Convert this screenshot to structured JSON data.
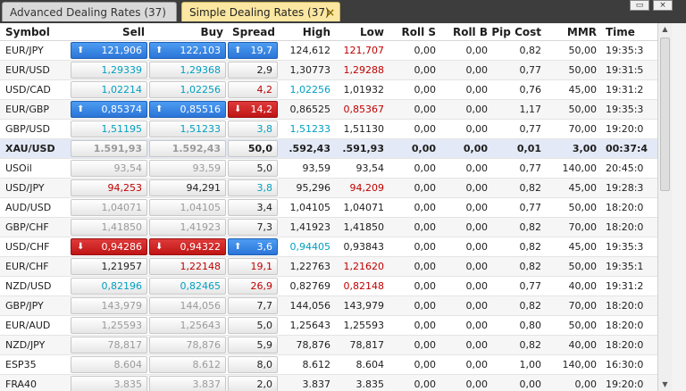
{
  "tabs": {
    "advanced": "Advanced Dealing Rates (37)",
    "simple": "Simple Dealing Rates (37)",
    "close": "×"
  },
  "window": {
    "restore": "▭",
    "close": "×"
  },
  "columns": [
    "Symbol",
    "Sell",
    "Buy",
    "Spread",
    "High",
    "Low",
    "Roll S",
    "Roll B",
    "Pip Cost",
    "MMR",
    "Time"
  ],
  "colors": {
    "up": "#2b75d8",
    "down": "#bf1515",
    "cyan_text": "#00a0c0",
    "red_text": "#c00000",
    "grey_text": "#9a9a9a",
    "tab_active": "#fbe7a1"
  },
  "rows": [
    {
      "symbol": "EUR/JPY",
      "sell": "121,906",
      "buy": "122,103",
      "spread": "19,7",
      "high": "124,612",
      "low": "121,707",
      "roll_s": "0,00",
      "roll_b": "0,00",
      "pip_cost": "0,82",
      "mmr": "50,00",
      "time": "19:35:3",
      "sell_style": "up",
      "buy_style": "up",
      "spread_style": "up",
      "low_color": "red"
    },
    {
      "symbol": "EUR/USD",
      "sell": "1,29339",
      "buy": "1,29368",
      "spread": "2,9",
      "high": "1,30773",
      "low": "1,29288",
      "roll_s": "0,00",
      "roll_b": "0,00",
      "pip_cost": "0,77",
      "mmr": "50,00",
      "time": "19:31:5",
      "sell_color": "cyan",
      "buy_color": "cyan",
      "low_color": "red"
    },
    {
      "symbol": "USD/CAD",
      "sell": "1,02214",
      "buy": "1,02256",
      "spread": "4,2",
      "high": "1,02256",
      "low": "1,01932",
      "roll_s": "0,00",
      "roll_b": "0,00",
      "pip_cost": "0,76",
      "mmr": "45,00",
      "time": "19:31:2",
      "sell_color": "cyan",
      "buy_color": "cyan",
      "spread_color": "red",
      "high_color": "cyan"
    },
    {
      "symbol": "EUR/GBP",
      "sell": "0,85374",
      "buy": "0,85516",
      "spread": "14,2",
      "high": "0,86525",
      "low": "0,85367",
      "roll_s": "0,00",
      "roll_b": "0,00",
      "pip_cost": "1,17",
      "mmr": "50,00",
      "time": "19:35:3",
      "sell_style": "up",
      "buy_style": "up",
      "spread_style": "down",
      "low_color": "red"
    },
    {
      "symbol": "GBP/USD",
      "sell": "1,51195",
      "buy": "1,51233",
      "spread": "3,8",
      "high": "1,51233",
      "low": "1,51130",
      "roll_s": "0,00",
      "roll_b": "0,00",
      "pip_cost": "0,77",
      "mmr": "70,00",
      "time": "19:20:0",
      "sell_color": "cyan",
      "buy_color": "cyan",
      "spread_color": "cyan",
      "high_color": "cyan"
    },
    {
      "symbol": "XAU/USD",
      "sell": "1.591,93",
      "buy": "1.592,43",
      "spread": "50,0",
      "high": ".592,43",
      "low": ".591,93",
      "roll_s": "0,00",
      "roll_b": "0,00",
      "pip_cost": "0,01",
      "mmr": "3,00",
      "time": "00:37:4",
      "sell_color": "grey",
      "buy_color": "grey",
      "selected": true
    },
    {
      "symbol": "USOil",
      "sell": "93,54",
      "buy": "93,59",
      "spread": "5,0",
      "high": "93,59",
      "low": "93,54",
      "roll_s": "0,00",
      "roll_b": "0,00",
      "pip_cost": "0,77",
      "mmr": "140,00",
      "time": "20:45:0",
      "sell_color": "grey",
      "buy_color": "grey"
    },
    {
      "symbol": "USD/JPY",
      "sell": "94,253",
      "buy": "94,291",
      "spread": "3,8",
      "high": "95,296",
      "low": "94,209",
      "roll_s": "0,00",
      "roll_b": "0,00",
      "pip_cost": "0,82",
      "mmr": "45,00",
      "time": "19:28:3",
      "sell_color": "red",
      "spread_color": "cyan",
      "low_color": "red"
    },
    {
      "symbol": "AUD/USD",
      "sell": "1,04071",
      "buy": "1,04105",
      "spread": "3,4",
      "high": "1,04105",
      "low": "1,04071",
      "roll_s": "0,00",
      "roll_b": "0,00",
      "pip_cost": "0,77",
      "mmr": "50,00",
      "time": "18:20:0",
      "sell_color": "grey",
      "buy_color": "grey"
    },
    {
      "symbol": "GBP/CHF",
      "sell": "1,41850",
      "buy": "1,41923",
      "spread": "7,3",
      "high": "1,41923",
      "low": "1,41850",
      "roll_s": "0,00",
      "roll_b": "0,00",
      "pip_cost": "0,82",
      "mmr": "70,00",
      "time": "18:20:0",
      "sell_color": "grey",
      "buy_color": "grey"
    },
    {
      "symbol": "USD/CHF",
      "sell": "0,94286",
      "buy": "0,94322",
      "spread": "3,6",
      "high": "0,94405",
      "low": "0,93843",
      "roll_s": "0,00",
      "roll_b": "0,00",
      "pip_cost": "0,82",
      "mmr": "45,00",
      "time": "19:35:3",
      "sell_style": "down",
      "buy_style": "down",
      "spread_style": "up",
      "high_color": "cyan"
    },
    {
      "symbol": "EUR/CHF",
      "sell": "1,21957",
      "buy": "1,22148",
      "spread": "19,1",
      "high": "1,22763",
      "low": "1,21620",
      "roll_s": "0,00",
      "roll_b": "0,00",
      "pip_cost": "0,82",
      "mmr": "50,00",
      "time": "19:35:1",
      "buy_color": "red",
      "spread_color": "red",
      "low_color": "red"
    },
    {
      "symbol": "NZD/USD",
      "sell": "0,82196",
      "buy": "0,82465",
      "spread": "26,9",
      "high": "0,82769",
      "low": "0,82148",
      "roll_s": "0,00",
      "roll_b": "0,00",
      "pip_cost": "0,77",
      "mmr": "40,00",
      "time": "19:31:2",
      "sell_color": "cyan",
      "buy_color": "cyan",
      "spread_color": "red",
      "low_color": "red"
    },
    {
      "symbol": "GBP/JPY",
      "sell": "143,979",
      "buy": "144,056",
      "spread": "7,7",
      "high": "144,056",
      "low": "143,979",
      "roll_s": "0,00",
      "roll_b": "0,00",
      "pip_cost": "0,82",
      "mmr": "70,00",
      "time": "18:20:0",
      "sell_color": "grey",
      "buy_color": "grey"
    },
    {
      "symbol": "EUR/AUD",
      "sell": "1,25593",
      "buy": "1,25643",
      "spread": "5,0",
      "high": "1,25643",
      "low": "1,25593",
      "roll_s": "0,00",
      "roll_b": "0,00",
      "pip_cost": "0,80",
      "mmr": "50,00",
      "time": "18:20:0",
      "sell_color": "grey",
      "buy_color": "grey"
    },
    {
      "symbol": "NZD/JPY",
      "sell": "78,817",
      "buy": "78,876",
      "spread": "5,9",
      "high": "78,876",
      "low": "78,817",
      "roll_s": "0,00",
      "roll_b": "0,00",
      "pip_cost": "0,82",
      "mmr": "40,00",
      "time": "18:20:0",
      "sell_color": "grey",
      "buy_color": "grey"
    },
    {
      "symbol": "ESP35",
      "sell": "8.604",
      "buy": "8.612",
      "spread": "8,0",
      "high": "8.612",
      "low": "8.604",
      "roll_s": "0,00",
      "roll_b": "0,00",
      "pip_cost": "1,00",
      "mmr": "140,00",
      "time": "16:30:0",
      "sell_color": "grey",
      "buy_color": "grey"
    },
    {
      "symbol": "FRA40",
      "sell": "3.835",
      "buy": "3.837",
      "spread": "2,0",
      "high": "3.837",
      "low": "3.835",
      "roll_s": "0,00",
      "roll_b": "0,00",
      "pip_cost": "0,00",
      "mmr": "0,00",
      "time": "19:20:0",
      "sell_color": "grey",
      "buy_color": "grey"
    }
  ]
}
